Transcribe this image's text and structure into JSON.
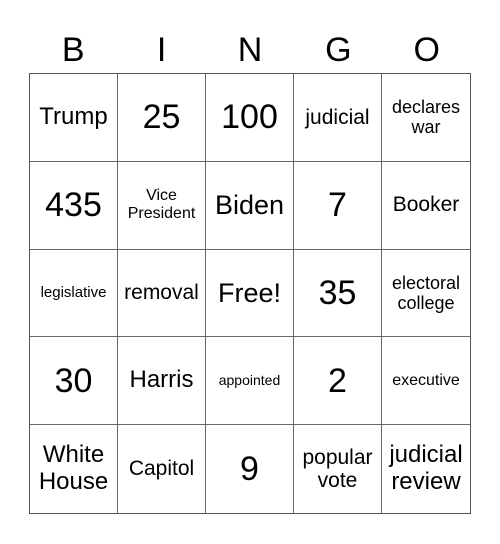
{
  "header": [
    "B",
    "I",
    "N",
    "G",
    "O"
  ],
  "cells": [
    {
      "text": "Trump",
      "size": "l"
    },
    {
      "text": "25",
      "size": "num"
    },
    {
      "text": "100",
      "size": "num"
    },
    {
      "text": "judicial",
      "size": "m"
    },
    {
      "text": "declares war",
      "size": "sm"
    },
    {
      "text": "435",
      "size": "num"
    },
    {
      "text": "Vice President",
      "size": "s"
    },
    {
      "text": "Biden",
      "size": "xl"
    },
    {
      "text": "7",
      "size": "num"
    },
    {
      "text": "Booker",
      "size": "m"
    },
    {
      "text": "legislative",
      "size": "xs"
    },
    {
      "text": "removal",
      "size": "m"
    },
    {
      "text": "Free!",
      "size": "xl"
    },
    {
      "text": "35",
      "size": "num"
    },
    {
      "text": "electoral college",
      "size": "sm"
    },
    {
      "text": "30",
      "size": "num"
    },
    {
      "text": "Harris",
      "size": "l"
    },
    {
      "text": "appointed",
      "size": "xxs"
    },
    {
      "text": "2",
      "size": "num"
    },
    {
      "text": "executive",
      "size": "s"
    },
    {
      "text": "White House",
      "size": "l"
    },
    {
      "text": "Capitol",
      "size": "m"
    },
    {
      "text": "9",
      "size": "num"
    },
    {
      "text": "popular vote",
      "size": "m"
    },
    {
      "text": "judicial review",
      "size": "l"
    }
  ]
}
